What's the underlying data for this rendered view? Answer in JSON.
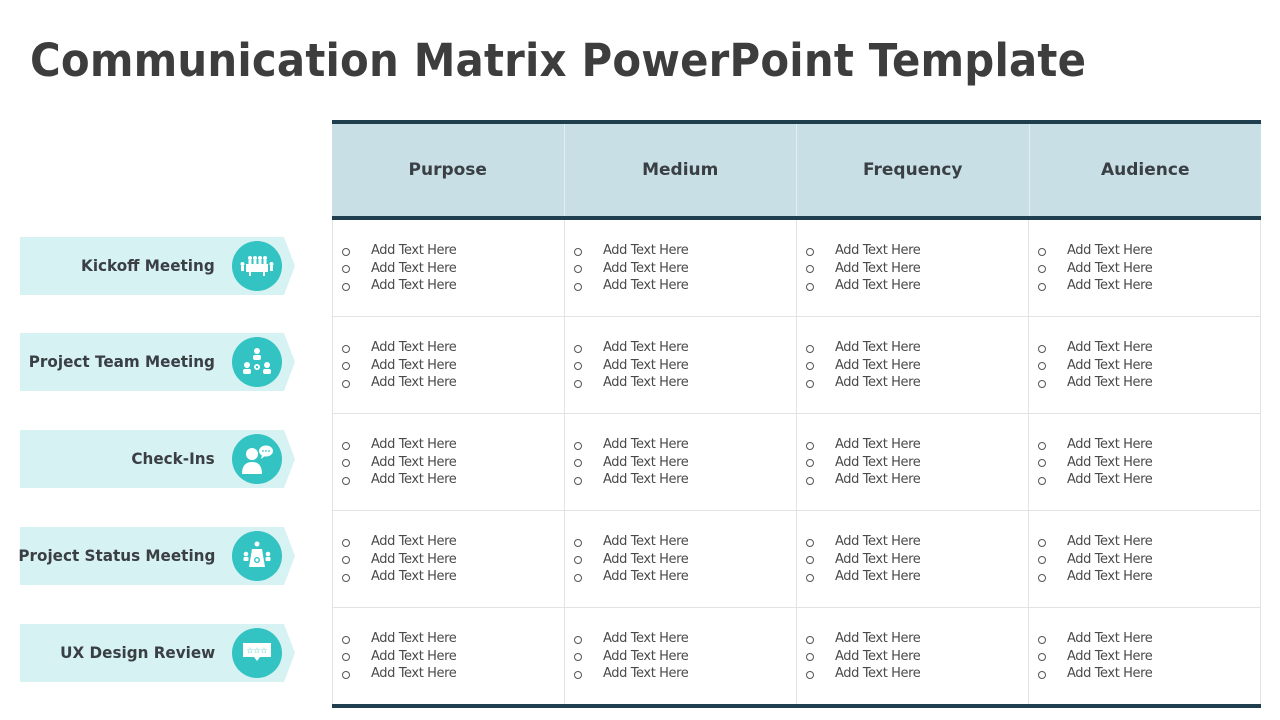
{
  "title": "Communication Matrix PowerPoint Template",
  "colors": {
    "accent": "#33c3c3",
    "label_bg": "#d7f2f3",
    "header_bg": "#c8dfe6",
    "border_dark": "#1f3f4f",
    "text": "#3d3d3d"
  },
  "rows": [
    {
      "label": "Kickoff Meeting",
      "icon": "conference-table-icon"
    },
    {
      "label": "Project Team Meeting",
      "icon": "team-network-icon"
    },
    {
      "label": "Check-Ins",
      "icon": "person-speech-bubble-icon"
    },
    {
      "label": "Project Status Meeting",
      "icon": "presentation-meeting-icon"
    },
    {
      "label": "UX Design Review",
      "icon": "star-rating-bubble-icon"
    }
  ],
  "table": {
    "columns": [
      "Purpose",
      "Medium",
      "Frequency",
      "Audience"
    ],
    "cells": [
      [
        [
          "Add Text Here",
          "Add Text Here",
          "Add Text Here"
        ],
        [
          "Add Text Here",
          "Add Text Here",
          "Add Text Here"
        ],
        [
          "Add Text Here",
          "Add Text Here",
          "Add Text Here"
        ],
        [
          "Add Text Here",
          "Add Text Here",
          "Add Text Here"
        ]
      ],
      [
        [
          "Add Text Here",
          "Add Text Here",
          "Add Text Here"
        ],
        [
          "Add Text Here",
          "Add Text Here",
          "Add Text Here"
        ],
        [
          "Add Text Here",
          "Add Text Here",
          "Add Text Here"
        ],
        [
          "Add Text Here",
          "Add Text Here",
          "Add Text Here"
        ]
      ],
      [
        [
          "Add Text Here",
          "Add Text Here",
          "Add Text Here"
        ],
        [
          "Add Text Here",
          "Add Text Here",
          "Add Text Here"
        ],
        [
          "Add Text Here",
          "Add Text Here",
          "Add Text Here"
        ],
        [
          "Add Text Here",
          "Add Text Here",
          "Add Text Here"
        ]
      ],
      [
        [
          "Add Text Here",
          "Add Text Here",
          "Add Text Here"
        ],
        [
          "Add Text Here",
          "Add Text Here",
          "Add Text Here"
        ],
        [
          "Add Text Here",
          "Add Text Here",
          "Add Text Here"
        ],
        [
          "Add Text Here",
          "Add Text Here",
          "Add Text Here"
        ]
      ],
      [
        [
          "Add Text Here",
          "Add Text Here",
          "Add Text Here"
        ],
        [
          "Add Text Here",
          "Add Text Here",
          "Add Text Here"
        ],
        [
          "Add Text Here",
          "Add Text Here",
          "Add Text Here"
        ],
        [
          "Add Text Here",
          "Add Text Here",
          "Add Text Here"
        ]
      ]
    ]
  }
}
